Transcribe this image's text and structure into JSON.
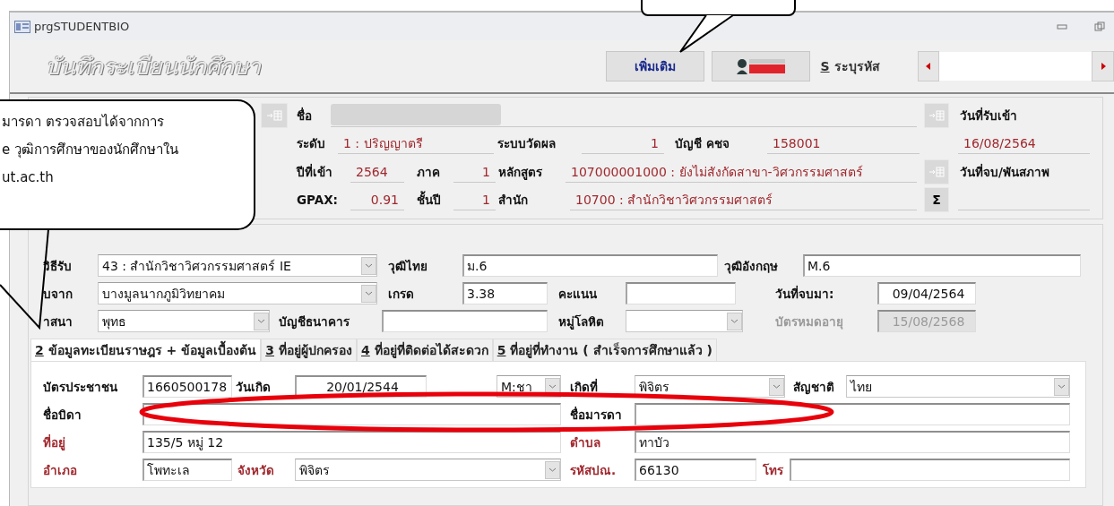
{
  "window": {
    "title": "prgSTUDENTBIO"
  },
  "header": {
    "title": "บันทึกระเบียนนักศึกษา",
    "add_button": "เพิ่มเติม",
    "search": {
      "key": "S",
      "label": "ระบุรหัส"
    }
  },
  "summary": {
    "fields": [
      {
        "kind": "lookup_button"
      },
      {
        "label": "ชื่อ",
        "kind": "name"
      },
      {
        "kind": "lookup_button"
      },
      {
        "kind": "caption",
        "text": "วันที่รับเข้า"
      },
      {
        "label": "ระดับ",
        "kind": "value",
        "text": "1 : ปริญญาตรี"
      },
      {
        "label": "ระบบวัดผล",
        "kind": "number",
        "text": "1"
      },
      {
        "label": "บัญชี คชจ",
        "kind": "value",
        "text": "158001"
      },
      {
        "kind": "value",
        "text": "16/08/2564"
      },
      {
        "label": "ปีที่เข้า",
        "kind": "value",
        "text": "2564"
      },
      {
        "label": "ภาค",
        "kind": "number",
        "text": "1"
      },
      {
        "label": "หลักสูตร",
        "kind": "value",
        "text": "107000001000 : ยังไม่สังกัดสาขา-วิศวกรรมศาสตร์"
      },
      {
        "kind": "lookup_button"
      },
      {
        "kind": "caption",
        "text": "วันที่จบ/พันสภาพ"
      },
      {
        "label": "GPAX:",
        "kind": "number",
        "text": "0.91"
      },
      {
        "label": "ชั้นปี",
        "kind": "number",
        "text": "1"
      },
      {
        "label": "สำนัก",
        "kind": "value",
        "text": "10700 : สำนักวิชาวิศวกรรมศาสตร์"
      },
      {
        "kind": "sigma",
        "text": "Σ"
      },
      {
        "kind": "empty_line"
      }
    ]
  },
  "details": {
    "fields": [
      {
        "label": "วิธีรับ",
        "kind": "combo",
        "value": "43 : สำนักวิชาวิศวกรรมศาสตร์ IE",
        "disabled": false
      },
      {
        "label": "วุฒิไทย",
        "kind": "field",
        "value": "ม.6",
        "disabled": false
      },
      {
        "label": "วุฒิอังกฤษ",
        "kind": "field",
        "value": "M.6",
        "disabled": false
      },
      {
        "label": "บจาก",
        "kind": "combo",
        "value": "บางมูลนากภูมิวิทยาคม",
        "disabled": false
      },
      {
        "label": "เกรด",
        "kind": "field",
        "value": "3.38",
        "disabled": false
      },
      {
        "label": "คะแนน",
        "kind": "field",
        "disabled": false
      },
      {
        "label": "วันที่จบมา:",
        "kind": "date_field",
        "value": "09/04/2564",
        "disabled": false
      },
      {
        "label": "าสนา",
        "kind": "combo",
        "value": "พุทธ",
        "disabled": false
      },
      {
        "label": "บัญชีธนาคาร",
        "kind": "field",
        "disabled": false
      },
      {
        "label": "หมู่โลหิต",
        "kind": "combo",
        "disabled": false
      },
      {
        "label": "บัตรหมดอายุ",
        "kind": "date_field",
        "value": "15/08/2568",
        "disabled": true
      }
    ]
  },
  "tabs": [
    {
      "key": "2",
      "label": "ข้อมูลทะเบียนราษฎร + ข้อมูลเบื้องต้น",
      "selected": true
    },
    {
      "key": "3",
      "label": "ที่อยู่ผู้ปกครอง",
      "selected": false
    },
    {
      "key": "4",
      "label": "ที่อยู่ที่ติดต่อได้สะดวก",
      "selected": false
    },
    {
      "key": "5",
      "label": "ที่อยู่ที่ทำงาน ( สำเร็จการศึกษาแล้ว )",
      "selected": false
    }
  ],
  "tab_panel": {
    "fields": [
      {
        "label": "บัตรประชาชน",
        "required": false,
        "kind": "field",
        "value": "1660500178"
      },
      {
        "label": "วันเกิด",
        "required": false,
        "kind": "date_field",
        "value": "20/01/2544",
        "extra_combo": {
          "value": "M:ชา"
        }
      },
      {
        "label": "เกิดที่",
        "required": false,
        "kind": "combo",
        "value": "พิจิตร"
      },
      {
        "label": "สัญชาติ",
        "required": false,
        "kind": "combo",
        "value": "ไทย"
      },
      {
        "label": "ชื่อบิดา",
        "required": false,
        "kind": "field"
      },
      {
        "label": "ชื่อมารดา",
        "required": false,
        "kind": "field"
      },
      {
        "label": "ที่อยู่",
        "required": true,
        "kind": "field",
        "value": "135/5 หมู่ 12"
      },
      {
        "label": "ตำบล",
        "required": true,
        "kind": "field",
        "value": "ทาบัว"
      },
      {
        "label": "อำเภอ",
        "required": true,
        "kind": "field",
        "value": "โพทะเล"
      },
      {
        "label": "จังหวัด",
        "required": true,
        "kind": "combo",
        "value": "พิจิตร"
      },
      {
        "label": "รหัสปณ.",
        "required": true,
        "kind": "field",
        "value": "66130"
      },
      {
        "label": "โทร",
        "required": true,
        "kind": "field"
      }
    ]
  },
  "callout": {
    "lines": [
      "มารดา ตรวจสอบได้จากการ",
      "e วุฒิการศึกษาของนักศึกษาใน",
      "ut.ac.th"
    ]
  }
}
